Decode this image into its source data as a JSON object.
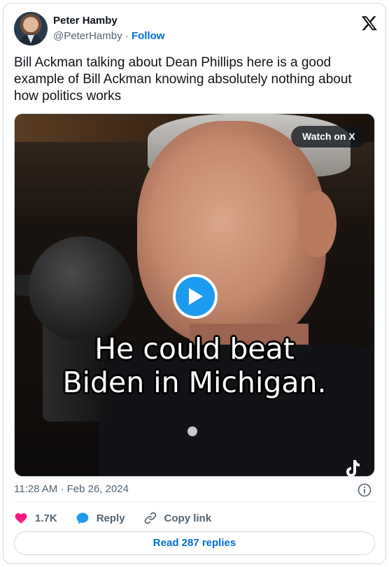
{
  "author": {
    "name": "Peter Hamby",
    "handle": "@PeterHamby",
    "separator": "·",
    "follow_label": "Follow"
  },
  "tweet": {
    "text": "Bill Ackman talking about Dean Phillips here is a good example of Bill Ackman knowing absolutely nothing about how politics works"
  },
  "media": {
    "watch_label": "Watch on X",
    "caption_line1": "He could beat",
    "caption_line2": "Biden in Michigan."
  },
  "meta": {
    "timestamp": "11:28 AM · Feb 26, 2024"
  },
  "actions": {
    "like_count": "1.7K",
    "reply_label": "Reply",
    "copy_link_label": "Copy link"
  },
  "read_replies_label": "Read 287 replies",
  "icons": [
    "x-logo-icon",
    "play-icon",
    "info-icon",
    "heart-icon",
    "reply-bubble-icon",
    "link-icon",
    "tiktok-icon"
  ],
  "colors": {
    "accent": "#1d9bf0",
    "link": "#006fd6",
    "like": "#f91880",
    "muted": "#536471"
  }
}
